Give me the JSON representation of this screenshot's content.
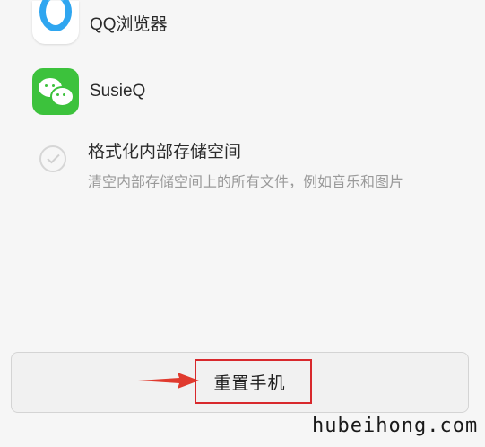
{
  "apps": [
    {
      "label": "QQ浏览器",
      "icon": "qq-browser-icon"
    },
    {
      "label": "SusieQ",
      "icon": "wechat-icon"
    }
  ],
  "format_option": {
    "title": "格式化内部存储空间",
    "description": "清空内部存储空间上的所有文件，例如音乐和图片",
    "checked": false,
    "icon": "check-circle-icon"
  },
  "reset": {
    "label": "重置手机"
  },
  "annotation": {
    "arrow_icon": "red-arrow-icon",
    "highlight_color": "#d8282c"
  },
  "watermark": "hubeihong.com",
  "colors": {
    "wechat_green": "#3cc23c",
    "qq_blue": "#2fa6f0",
    "background": "#f6f6f6"
  }
}
